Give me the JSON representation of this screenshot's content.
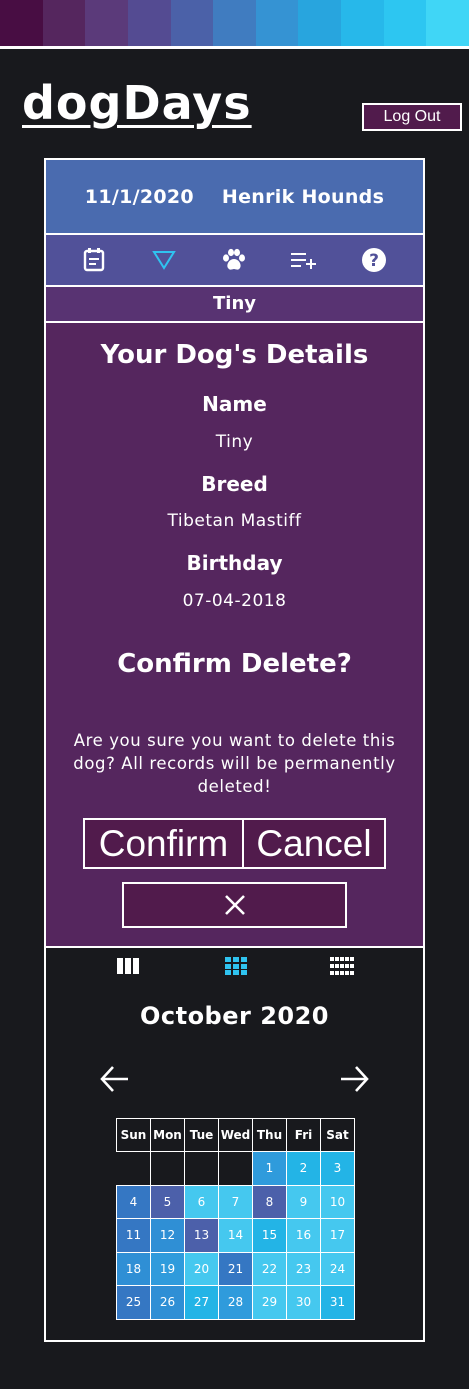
{
  "colors": {
    "stripe": [
      "#480d43",
      "#55265e",
      "#5b3a7a",
      "#544b92",
      "#4b61a8",
      "#407cc0",
      "#3593d3",
      "#28a5de",
      "#27b8ea",
      "#2dc6f1",
      "#40d6f6"
    ],
    "active_icon": "#2fc3f0",
    "logout_bg": "#511b4c"
  },
  "app": {
    "logo": "dogDays",
    "logout_label": "Log Out"
  },
  "header": {
    "date": "11/1/2020",
    "user": "Henrik Hounds"
  },
  "nav_icons": [
    "calendar-icon",
    "filter-triangle-icon",
    "paw-icon",
    "add-list-icon",
    "help-icon"
  ],
  "dog_bar": {
    "name": "Tiny"
  },
  "details": {
    "title": "Your Dog's Details",
    "name_label": "Name",
    "name_value": "Tiny",
    "breed_label": "Breed",
    "breed_value": "Tibetan Mastiff",
    "birthday_label": "Birthday",
    "birthday_value": "07-04-2018",
    "confirm_title": "Confirm Delete?",
    "confirm_message": "Are you sure you want to delete this dog? All records will be permanently deleted!",
    "confirm_label": "Confirm",
    "cancel_label": "Cancel"
  },
  "calendar": {
    "view_icons": [
      "week-view-icon",
      "month-view-icon",
      "year-view-icon"
    ],
    "month_title": "October 2020",
    "weekdays": [
      "Sun",
      "Mon",
      "Tue",
      "Wed",
      "Thu",
      "Fri",
      "Sat"
    ],
    "weeks": [
      [
        null,
        null,
        null,
        null,
        {
          "d": "1",
          "c": "c3"
        },
        {
          "d": "2",
          "c": "c6"
        },
        {
          "d": "3",
          "c": "c6"
        }
      ],
      [
        {
          "d": "4",
          "c": "c5"
        },
        {
          "d": "5",
          "c": "c4"
        },
        {
          "d": "6",
          "c": "c2"
        },
        {
          "d": "7",
          "c": "c2"
        },
        {
          "d": "8",
          "c": "c4"
        },
        {
          "d": "9",
          "c": "c2"
        },
        {
          "d": "10",
          "c": "c2"
        }
      ],
      [
        {
          "d": "11",
          "c": "c5"
        },
        {
          "d": "12",
          "c": "c1"
        },
        {
          "d": "13",
          "c": "c4"
        },
        {
          "d": "14",
          "c": "c2"
        },
        {
          "d": "15",
          "c": "c6"
        },
        {
          "d": "16",
          "c": "c2"
        },
        {
          "d": "17",
          "c": "c2"
        }
      ],
      [
        {
          "d": "18",
          "c": "c1"
        },
        {
          "d": "19",
          "c": "c3"
        },
        {
          "d": "20",
          "c": "c2"
        },
        {
          "d": "21",
          "c": "c5"
        },
        {
          "d": "22",
          "c": "c2"
        },
        {
          "d": "23",
          "c": "c2"
        },
        {
          "d": "24",
          "c": "c2"
        }
      ],
      [
        {
          "d": "25",
          "c": "c5"
        },
        {
          "d": "26",
          "c": "c1"
        },
        {
          "d": "27",
          "c": "c6"
        },
        {
          "d": "28",
          "c": "c3"
        },
        {
          "d": "29",
          "c": "c2"
        },
        {
          "d": "30",
          "c": "c2"
        },
        {
          "d": "31",
          "c": "c6"
        }
      ]
    ]
  }
}
